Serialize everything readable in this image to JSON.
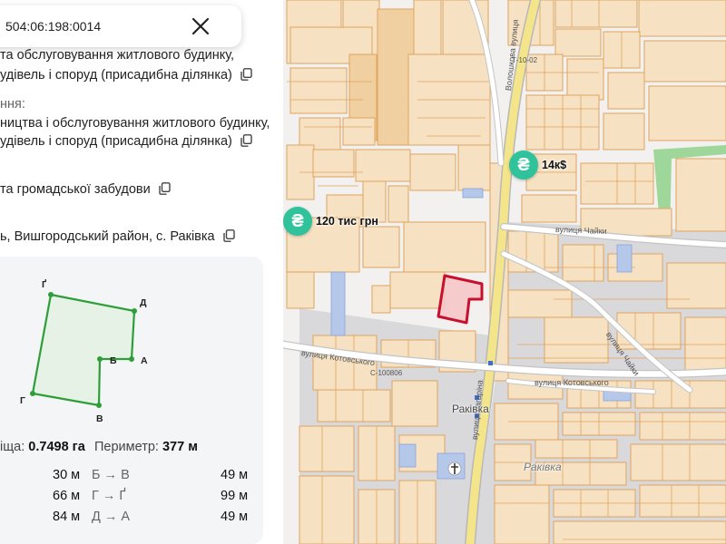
{
  "search": {
    "value": "504:06:198:0014"
  },
  "purpose": {
    "line1": "та обслуговування житлового будинку,",
    "line2": "удівель і споруд (присадибна ділянка)"
  },
  "purpose_label": "ння:",
  "purpose2": {
    "line1": "ництва і обслуговування житлового будинку,",
    "line2": "удівель і споруд (присадибна ділянка)"
  },
  "category": "та громадської забудови",
  "location": "ь, Вишгородський район, с. Ракiвка",
  "shape": {
    "vertices": [
      "Ґ",
      "Д",
      "А",
      "Б",
      "В",
      "Г"
    ]
  },
  "stats": {
    "area_label": "іща:",
    "area_value": "0.7498 га",
    "perimeter_label": "Периметр:",
    "perimeter_value": "377 м"
  },
  "edges_left": [
    {
      "value": "30 м"
    },
    {
      "value": "66 м"
    },
    {
      "value": "84 м"
    }
  ],
  "edges_right": [
    {
      "label": "Б → В",
      "value": "49 м"
    },
    {
      "label": "Г → Ґ",
      "value": "99 м"
    },
    {
      "label": "Д → А",
      "value": "49 м"
    }
  ],
  "map": {
    "prices": [
      {
        "symbol": "₴",
        "text": "14к$"
      },
      {
        "symbol": "₴",
        "text": "120 тис грн"
      }
    ],
    "streets": {
      "volosh": "Волошкова вулиця",
      "t1002": "Т-10-02",
      "chaiky": "вулиця Чайки",
      "chaiky2": "вулиця Чайки",
      "kotov": "вулиця Котовського",
      "kotov2": "вулиця Котовського",
      "c100806": "С-100806",
      "gagarina": "вулиця Гагаріна"
    },
    "places": {
      "village": "Раківка",
      "village2": "Ракiвка"
    }
  },
  "colors": {
    "parcel_fill": "#f6e2c3",
    "parcel_stroke": "#e0a45c",
    "selected_stroke": "#c8102e",
    "shape_fill": "#e6f2e6",
    "shape_stroke": "#2e9e3a",
    "price_badge": "#2fc29b"
  }
}
